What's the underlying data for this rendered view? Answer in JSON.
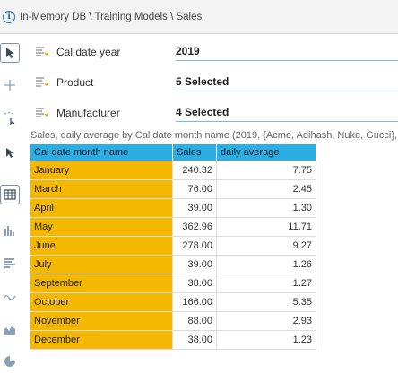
{
  "breadcrumb": "In-Memory DB \\ Training Models \\ Sales",
  "filters": [
    {
      "label": "Cal date year",
      "value": "2019"
    },
    {
      "label": "Product",
      "value": "5 Selected"
    },
    {
      "label": "Manufacturer",
      "value": "4 Selected"
    }
  ],
  "caption": "Sales, daily average by Cal date month name (2019, {Acme, Adihash, Nuke, Gucci}, {",
  "table": {
    "headers": [
      "Cal date month name",
      "Sales",
      "daily average"
    ],
    "rows": [
      {
        "month": "January",
        "sales": "240.32",
        "avg": "7.75"
      },
      {
        "month": "March",
        "sales": "76.00",
        "avg": "2.45"
      },
      {
        "month": "April",
        "sales": "39.00",
        "avg": "1.30"
      },
      {
        "month": "May",
        "sales": "362.96",
        "avg": "11.71"
      },
      {
        "month": "June",
        "sales": "278.00",
        "avg": "9.27"
      },
      {
        "month": "July",
        "sales": "39.00",
        "avg": "1.26"
      },
      {
        "month": "September",
        "sales": "38.00",
        "avg": "1.27"
      },
      {
        "month": "October",
        "sales": "166.00",
        "avg": "5.35"
      },
      {
        "month": "November",
        "sales": "88.00",
        "avg": "2.93"
      },
      {
        "month": "December",
        "sales": "38.00",
        "avg": "1.23"
      }
    ]
  },
  "colors": {
    "header_bg": "#2aaee4",
    "month_bg": "#f5b800",
    "filter_underline": "#7fb8d8"
  },
  "icons": [
    "info-icon",
    "pointer-icon",
    "crosshair-icon",
    "lasso-icon",
    "drill-icon",
    "table-icon",
    "bar-chart-icon",
    "horizontal-bar-icon",
    "line-chart-icon",
    "area-chart-icon",
    "pie-chart-icon",
    "filter-icon"
  ]
}
